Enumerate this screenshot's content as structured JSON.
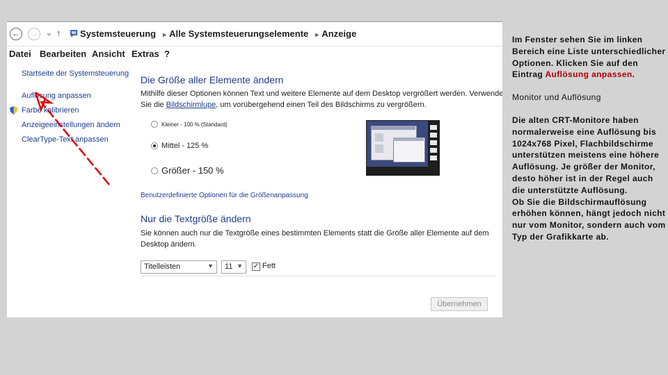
{
  "address_bar": {
    "crumbs": [
      "Systemsteuerung",
      "Alle Systemsteuerungselemente",
      "Anzeige"
    ]
  },
  "menu": {
    "items": [
      "Datei",
      "Bearbeiten",
      "Ansicht",
      "Extras",
      "?"
    ]
  },
  "sidebar": {
    "items": [
      {
        "label": "Startseite der Systemsteuerung"
      },
      {
        "label": "Auflösung anpassen"
      },
      {
        "label": "Farbe kalibrieren"
      },
      {
        "label": "Anzeigeeinstellungen ändern"
      },
      {
        "label": "ClearType-Text anpassen"
      }
    ]
  },
  "size_section": {
    "heading": "Die Größe aller Elemente ändern",
    "desc_line1": "Mithilfe dieser Optionen können Text und weitere Elemente auf dem Desktop vergrößert werden. Verwenden",
    "desc_line2_pre": "Sie die ",
    "desc_link": "Bildschirmlupe",
    "desc_line2_post": ", um vorübergehend einen Teil des Bildschirms zu vergrößern.",
    "options": [
      {
        "label": "Kleiner - 100 % (Standard)",
        "selected": false
      },
      {
        "label": "Mittel - 125 %",
        "selected": true
      },
      {
        "label": "Größer - 150 %",
        "selected": false
      }
    ],
    "custom_link": "Benutzerdefinierte Optionen für die Größenanpassung"
  },
  "text_section": {
    "heading": "Nur die Textgröße ändern",
    "desc_line1": "Sie können auch nur die Textgröße eines bestimmten Elements statt die Größe aller Elemente auf dem",
    "desc_line2": "Desktop ändern.",
    "element_select": "Titelleisten",
    "size_select": "11",
    "bold_label": "Fett",
    "bold_checked": "✓",
    "apply_label": "Übernehmen"
  },
  "notes": {
    "p1_pre": "Im Fenster sehen Sie im linken Bereich eine Liste unterschiedlicher Optionen. Klicken Sie auf den Eintrag ",
    "p1_highlight": "Auflösung anpassen",
    "p1_post": ".",
    "p2": "Monitor und Auflösung",
    "p3": "Die alten CRT-Monitore haben normalerweise eine Auflösung bis 1024x768 Pixel, Flachbildschirme unterstützen meistens eine höhere Auflösung. Je größer der Monitor, desto höher ist in der Regel auch die unterstützte Auflösung.",
    "p4": "Ob Sie die Bildschirmauflösung erhöhen können, hängt jedoch nicht nur vom Monitor, sondern auch vom Typ der Grafikkarte ab."
  },
  "colors": {
    "link": "#1c3e8c",
    "heading": "#1e3a8a",
    "highlight": "#b40000",
    "arrow": "#e00000"
  }
}
